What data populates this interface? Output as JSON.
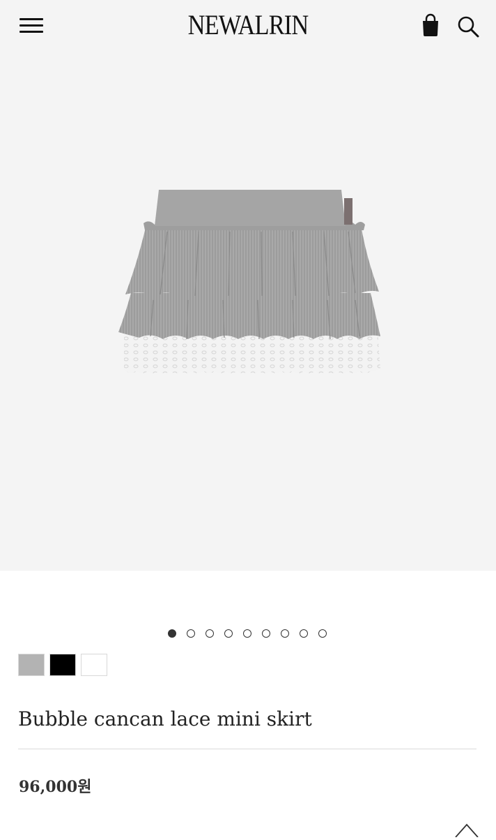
{
  "header": {
    "logo": "NEWALRIN",
    "menu_icon": "hamburger-menu-icon",
    "bag_icon": "shopping-bag-icon",
    "search_icon": "search-icon"
  },
  "gallery": {
    "image_count": 9,
    "active_index": 0
  },
  "swatches": [
    {
      "name": "gray",
      "color": "#b3b3b3"
    },
    {
      "name": "black",
      "color": "#000000"
    },
    {
      "name": "white",
      "color": "#ffffff"
    }
  ],
  "product": {
    "title": "Bubble cancan lace mini skirt",
    "price": "96,000원"
  },
  "scroll_top_icon": "chevron-up-icon"
}
